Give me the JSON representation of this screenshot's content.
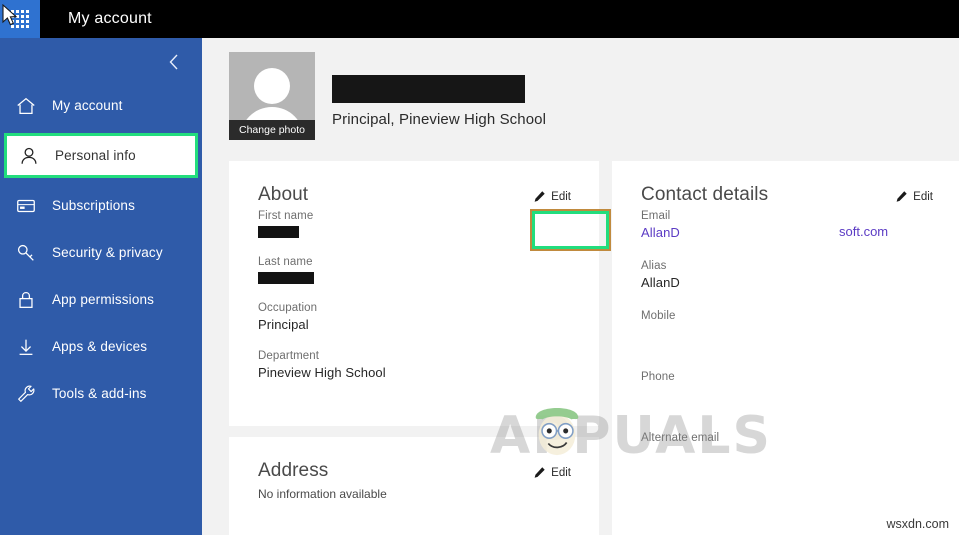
{
  "topbar": {
    "waffle_icon": "app-launcher-waffle-icon",
    "title": "My account"
  },
  "sidebar": {
    "collapse_icon": "chevron-left-icon",
    "items": [
      {
        "label": "My account",
        "icon": "home-icon",
        "selected": false
      },
      {
        "label": "Personal info",
        "icon": "person-icon",
        "selected": true
      },
      {
        "label": "Subscriptions",
        "icon": "card-icon",
        "selected": false
      },
      {
        "label": "Security & privacy",
        "icon": "key-icon",
        "selected": false
      },
      {
        "label": "App permissions",
        "icon": "lock-icon",
        "selected": false
      },
      {
        "label": "Apps & devices",
        "icon": "download-icon",
        "selected": false
      },
      {
        "label": "Tools & add-ins",
        "icon": "wrench-icon",
        "selected": false
      }
    ]
  },
  "profile": {
    "change_photo_label": "Change photo",
    "name_redacted": true,
    "subtitle": "Principal, Pineview High School"
  },
  "about_card": {
    "title": "About",
    "edit_label": "Edit",
    "edit_icon": "pencil-icon",
    "highlighted": true,
    "fields": [
      {
        "label": "First name",
        "value": "",
        "redacted": true
      },
      {
        "label": "Last name",
        "value": "",
        "redacted": true
      },
      {
        "label": "Occupation",
        "value": "Principal",
        "redacted": false
      },
      {
        "label": "Department",
        "value": "Pineview High School",
        "redacted": false
      }
    ]
  },
  "address_card": {
    "title": "Address",
    "edit_label": "Edit",
    "edit_icon": "pencil-icon",
    "empty_text": "No information available"
  },
  "contact_card": {
    "title": "Contact details",
    "edit_label": "Edit",
    "edit_icon": "pencil-icon",
    "fields": [
      {
        "label": "Email",
        "value": "AllanD",
        "suffix": "soft.com",
        "link": true
      },
      {
        "label": "Alias",
        "value": "AllanD",
        "suffix": "",
        "link": false
      },
      {
        "label": "Mobile",
        "value": "",
        "suffix": "",
        "link": false
      },
      {
        "label": "Phone",
        "value": "",
        "suffix": "",
        "link": false
      },
      {
        "label": "Alternate email",
        "value": "",
        "suffix": "",
        "link": false
      }
    ]
  },
  "watermark": {
    "text": "APPUALS",
    "credit": "wsxdn.com"
  },
  "colors": {
    "sidebar_blue": "#2f5ba9",
    "waffle_blue": "#2f72d0",
    "topbar_black": "#000000",
    "highlight_green": "#22dd7d",
    "highlight_outline": "#c08a3e",
    "link_purple": "#5b3bc4",
    "page_gray": "#f2f2f2"
  }
}
